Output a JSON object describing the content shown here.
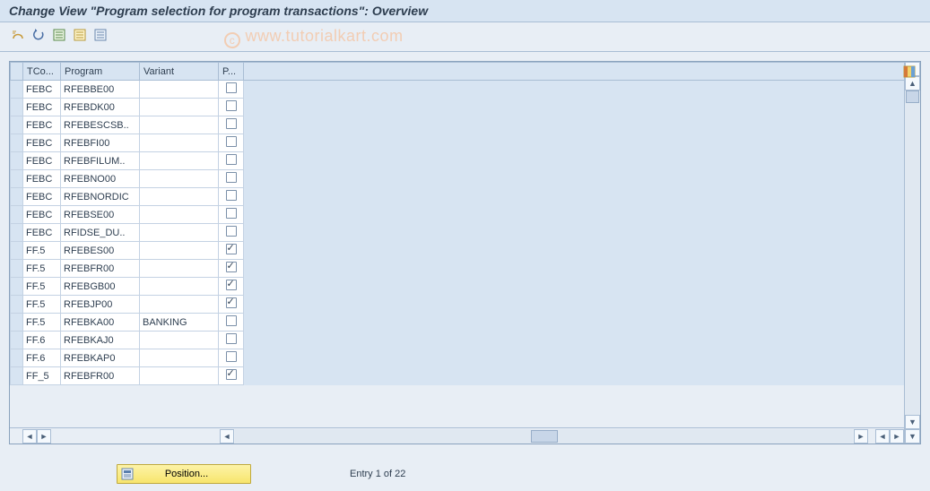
{
  "title": "Change View \"Program selection for program transactions\": Overview",
  "watermark": "www.tutorialkart.com",
  "columns": {
    "tcode": "TCo...",
    "program": "Program",
    "variant": "Variant",
    "p": "P..."
  },
  "rows": [
    {
      "tcode": "FEBC",
      "program": "RFEBBE00",
      "variant": "",
      "checked": false
    },
    {
      "tcode": "FEBC",
      "program": "RFEBDK00",
      "variant": "",
      "checked": false
    },
    {
      "tcode": "FEBC",
      "program": "RFEBESCSB..",
      "variant": "",
      "checked": false
    },
    {
      "tcode": "FEBC",
      "program": "RFEBFI00",
      "variant": "",
      "checked": false
    },
    {
      "tcode": "FEBC",
      "program": "RFEBFILUM..",
      "variant": "",
      "checked": false
    },
    {
      "tcode": "FEBC",
      "program": "RFEBNO00",
      "variant": "",
      "checked": false
    },
    {
      "tcode": "FEBC",
      "program": "RFEBNORDIC",
      "variant": "",
      "checked": false
    },
    {
      "tcode": "FEBC",
      "program": "RFEBSE00",
      "variant": "",
      "checked": false
    },
    {
      "tcode": "FEBC",
      "program": "RFIDSE_DU..",
      "variant": "",
      "checked": false
    },
    {
      "tcode": "FF.5",
      "program": "RFEBES00",
      "variant": "",
      "checked": true
    },
    {
      "tcode": "FF.5",
      "program": "RFEBFR00",
      "variant": "",
      "checked": true
    },
    {
      "tcode": "FF.5",
      "program": "RFEBGB00",
      "variant": "",
      "checked": true
    },
    {
      "tcode": "FF.5",
      "program": "RFEBJP00",
      "variant": "",
      "checked": true
    },
    {
      "tcode": "FF.5",
      "program": "RFEBKA00",
      "variant": "BANKING",
      "checked": false
    },
    {
      "tcode": "FF.6",
      "program": "RFEBKAJ0",
      "variant": "",
      "checked": false
    },
    {
      "tcode": "FF.6",
      "program": "RFEBKAP0",
      "variant": "",
      "checked": false
    },
    {
      "tcode": "FF_5",
      "program": "RFEBFR00",
      "variant": "",
      "checked": true
    }
  ],
  "footer": {
    "position_label": "Position...",
    "entry_text": "Entry 1 of 22"
  }
}
